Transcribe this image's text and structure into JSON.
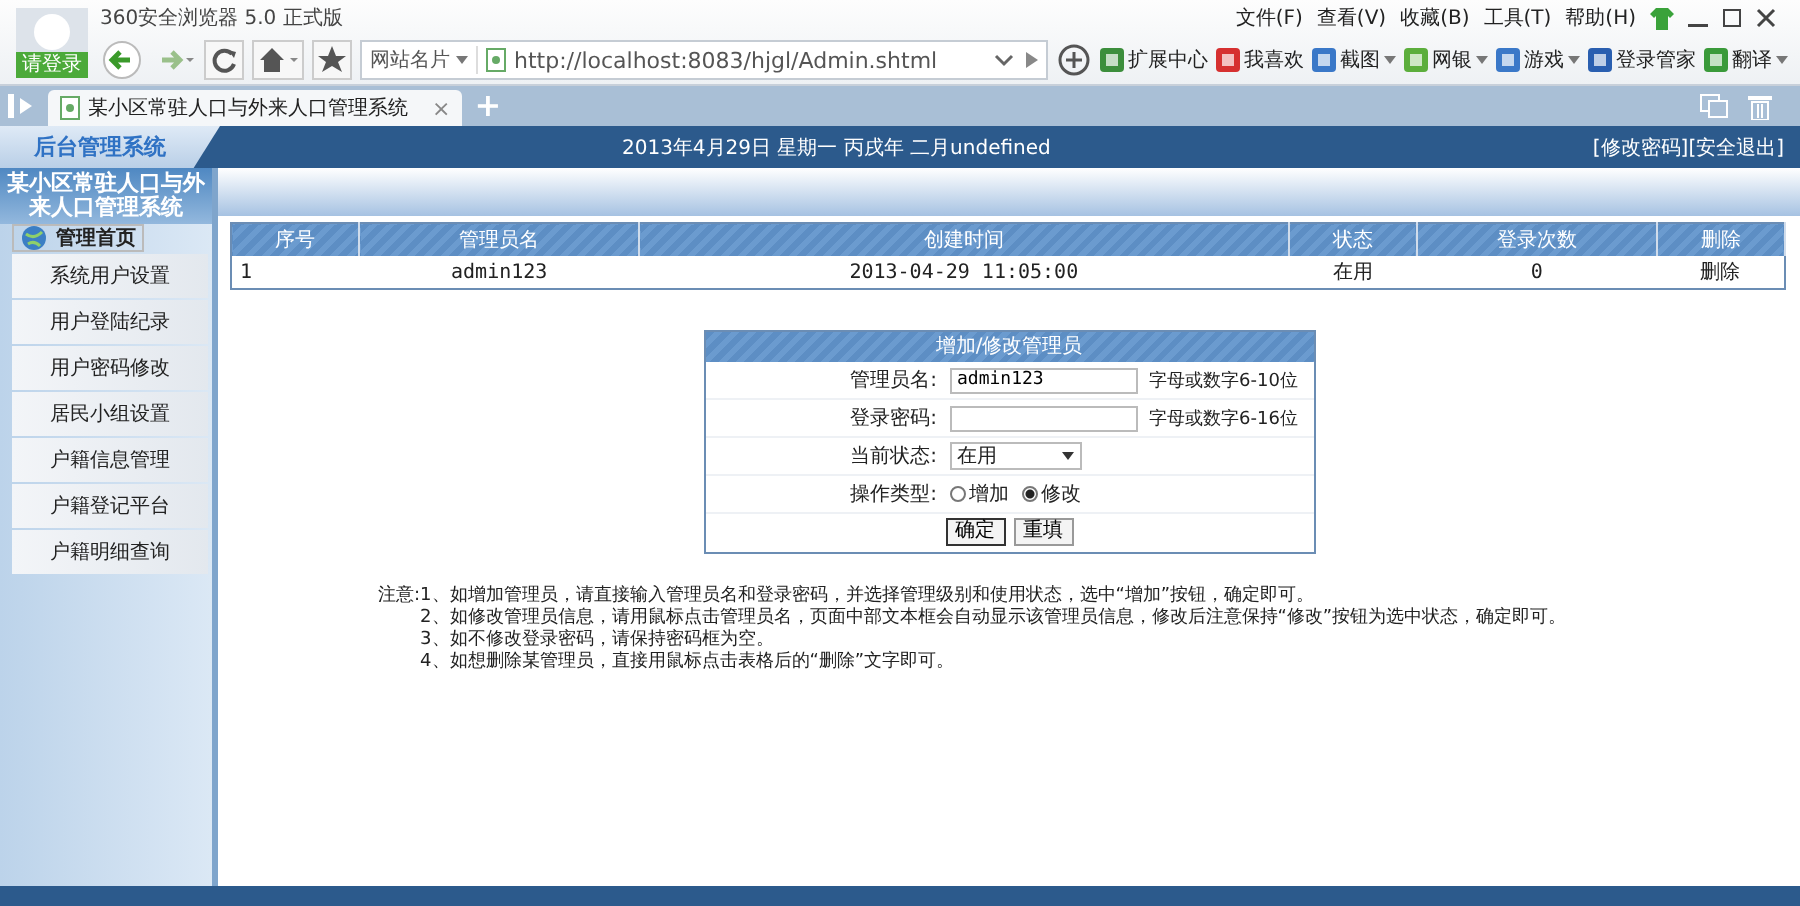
{
  "browser": {
    "title": "360安全浏览器 5.0 正式版",
    "login": "请登录",
    "menu": [
      "文件(F)",
      "查看(V)",
      "收藏(B)",
      "工具(T)",
      "帮助(H)"
    ],
    "site_card": "网站名片",
    "url": "http://localhost:8083/hjgl/Admin.shtml",
    "toolbar": [
      {
        "label": "扩展中心",
        "caret": false
      },
      {
        "label": "我喜欢",
        "caret": false
      },
      {
        "label": "截图",
        "caret": true
      },
      {
        "label": "网银",
        "caret": true
      },
      {
        "label": "游戏",
        "caret": true
      },
      {
        "label": "登录管家",
        "caret": false
      },
      {
        "label": "翻译",
        "caret": true
      }
    ],
    "tab": {
      "title": "某小区常驻人口与外来人口管理系统",
      "close": "×"
    },
    "new_tab": "+"
  },
  "header": {
    "logo": "后台管理系统",
    "date": "2013年4月29日 星期一 丙戌年 二月undefined",
    "links": [
      "[修改密码]",
      "[安全退出]"
    ]
  },
  "sidebar": {
    "title": "某小区常驻人口与外来人口管理系统",
    "items": [
      {
        "label": "管理首页",
        "kind": "home",
        "selected": true
      },
      {
        "label": "系统用户设置",
        "kind": "link",
        "selected": false
      },
      {
        "label": "用户登陆纪录",
        "kind": "link",
        "selected": false
      },
      {
        "label": "用户密码修改",
        "kind": "link",
        "selected": false
      },
      {
        "label": "居民小组设置",
        "kind": "link",
        "selected": false
      },
      {
        "label": "户籍信息管理",
        "kind": "link",
        "selected": false
      },
      {
        "label": "户籍登记平台",
        "kind": "link",
        "selected": false
      },
      {
        "label": "户籍明细查询",
        "kind": "link",
        "selected": false
      }
    ]
  },
  "table": {
    "columns": [
      "序号",
      "管理员名",
      "创建时间",
      "状态",
      "登录次数",
      "删除"
    ],
    "rows": [
      [
        "1",
        "admin123",
        "2013-04-29 11:05:00",
        "在用",
        "0",
        "删除"
      ]
    ]
  },
  "form": {
    "title": "增加/修改管理员",
    "fields": [
      {
        "label": "管理员名:",
        "kind": "text",
        "value": "admin123",
        "hint": "字母或数字6-10位"
      },
      {
        "label": "登录密码:",
        "kind": "text",
        "hint": "字母或数字6-16位"
      },
      {
        "label": "当前状态:",
        "kind": "select",
        "value": "在用"
      },
      {
        "label": "操作类型:",
        "kind": "radio",
        "options": [
          {
            "label": "增加",
            "selected": false
          },
          {
            "label": "修改",
            "selected": true
          }
        ]
      }
    ],
    "buttons": [
      "确定",
      "重填"
    ]
  },
  "notes": {
    "label": "注意:",
    "items": [
      "1、如增加管理员，请直接输入管理员名和登录密码，并选择管理级别和使用状态，选中“增加”按钮，确定即可。",
      "2、如修改管理员信息，请用鼠标点击管理员名，页面中部文本框会自动显示该管理员信息，修改后注意保持“修改”按钮为选中状态，确定即可。",
      "3、如不修改登录密码，请保持密码框为空。",
      "4、如想删除某管理员，直接用鼠标点击表格后的“删除”文字即可。"
    ]
  }
}
